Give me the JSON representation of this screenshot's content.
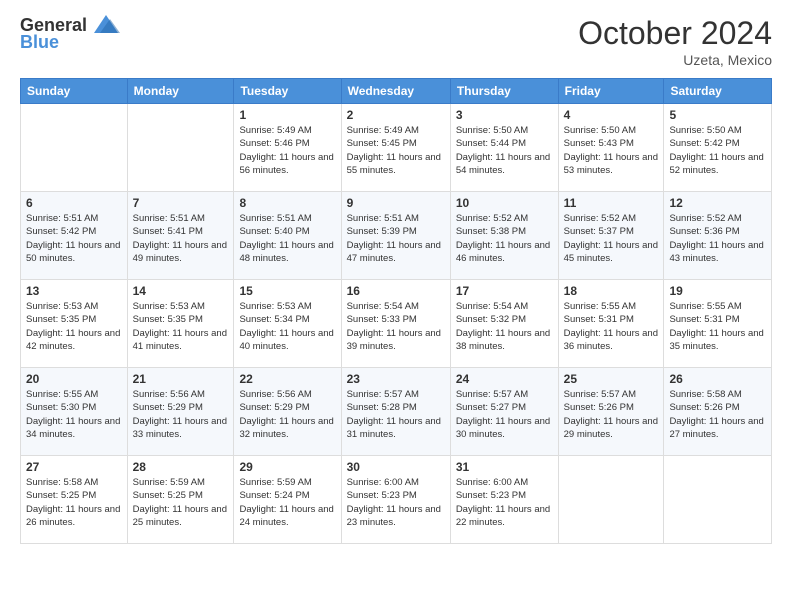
{
  "logo": {
    "line1": "General",
    "line2": "Blue"
  },
  "title": "October 2024",
  "location": "Uzeta, Mexico",
  "weekdays": [
    "Sunday",
    "Monday",
    "Tuesday",
    "Wednesday",
    "Thursday",
    "Friday",
    "Saturday"
  ],
  "weeks": [
    [
      {
        "day": "",
        "sunrise": "",
        "sunset": "",
        "daylight": ""
      },
      {
        "day": "",
        "sunrise": "",
        "sunset": "",
        "daylight": ""
      },
      {
        "day": "1",
        "sunrise": "Sunrise: 5:49 AM",
        "sunset": "Sunset: 5:46 PM",
        "daylight": "Daylight: 11 hours and 56 minutes."
      },
      {
        "day": "2",
        "sunrise": "Sunrise: 5:49 AM",
        "sunset": "Sunset: 5:45 PM",
        "daylight": "Daylight: 11 hours and 55 minutes."
      },
      {
        "day": "3",
        "sunrise": "Sunrise: 5:50 AM",
        "sunset": "Sunset: 5:44 PM",
        "daylight": "Daylight: 11 hours and 54 minutes."
      },
      {
        "day": "4",
        "sunrise": "Sunrise: 5:50 AM",
        "sunset": "Sunset: 5:43 PM",
        "daylight": "Daylight: 11 hours and 53 minutes."
      },
      {
        "day": "5",
        "sunrise": "Sunrise: 5:50 AM",
        "sunset": "Sunset: 5:42 PM",
        "daylight": "Daylight: 11 hours and 52 minutes."
      }
    ],
    [
      {
        "day": "6",
        "sunrise": "Sunrise: 5:51 AM",
        "sunset": "Sunset: 5:42 PM",
        "daylight": "Daylight: 11 hours and 50 minutes."
      },
      {
        "day": "7",
        "sunrise": "Sunrise: 5:51 AM",
        "sunset": "Sunset: 5:41 PM",
        "daylight": "Daylight: 11 hours and 49 minutes."
      },
      {
        "day": "8",
        "sunrise": "Sunrise: 5:51 AM",
        "sunset": "Sunset: 5:40 PM",
        "daylight": "Daylight: 11 hours and 48 minutes."
      },
      {
        "day": "9",
        "sunrise": "Sunrise: 5:51 AM",
        "sunset": "Sunset: 5:39 PM",
        "daylight": "Daylight: 11 hours and 47 minutes."
      },
      {
        "day": "10",
        "sunrise": "Sunrise: 5:52 AM",
        "sunset": "Sunset: 5:38 PM",
        "daylight": "Daylight: 11 hours and 46 minutes."
      },
      {
        "day": "11",
        "sunrise": "Sunrise: 5:52 AM",
        "sunset": "Sunset: 5:37 PM",
        "daylight": "Daylight: 11 hours and 45 minutes."
      },
      {
        "day": "12",
        "sunrise": "Sunrise: 5:52 AM",
        "sunset": "Sunset: 5:36 PM",
        "daylight": "Daylight: 11 hours and 43 minutes."
      }
    ],
    [
      {
        "day": "13",
        "sunrise": "Sunrise: 5:53 AM",
        "sunset": "Sunset: 5:35 PM",
        "daylight": "Daylight: 11 hours and 42 minutes."
      },
      {
        "day": "14",
        "sunrise": "Sunrise: 5:53 AM",
        "sunset": "Sunset: 5:35 PM",
        "daylight": "Daylight: 11 hours and 41 minutes."
      },
      {
        "day": "15",
        "sunrise": "Sunrise: 5:53 AM",
        "sunset": "Sunset: 5:34 PM",
        "daylight": "Daylight: 11 hours and 40 minutes."
      },
      {
        "day": "16",
        "sunrise": "Sunrise: 5:54 AM",
        "sunset": "Sunset: 5:33 PM",
        "daylight": "Daylight: 11 hours and 39 minutes."
      },
      {
        "day": "17",
        "sunrise": "Sunrise: 5:54 AM",
        "sunset": "Sunset: 5:32 PM",
        "daylight": "Daylight: 11 hours and 38 minutes."
      },
      {
        "day": "18",
        "sunrise": "Sunrise: 5:55 AM",
        "sunset": "Sunset: 5:31 PM",
        "daylight": "Daylight: 11 hours and 36 minutes."
      },
      {
        "day": "19",
        "sunrise": "Sunrise: 5:55 AM",
        "sunset": "Sunset: 5:31 PM",
        "daylight": "Daylight: 11 hours and 35 minutes."
      }
    ],
    [
      {
        "day": "20",
        "sunrise": "Sunrise: 5:55 AM",
        "sunset": "Sunset: 5:30 PM",
        "daylight": "Daylight: 11 hours and 34 minutes."
      },
      {
        "day": "21",
        "sunrise": "Sunrise: 5:56 AM",
        "sunset": "Sunset: 5:29 PM",
        "daylight": "Daylight: 11 hours and 33 minutes."
      },
      {
        "day": "22",
        "sunrise": "Sunrise: 5:56 AM",
        "sunset": "Sunset: 5:29 PM",
        "daylight": "Daylight: 11 hours and 32 minutes."
      },
      {
        "day": "23",
        "sunrise": "Sunrise: 5:57 AM",
        "sunset": "Sunset: 5:28 PM",
        "daylight": "Daylight: 11 hours and 31 minutes."
      },
      {
        "day": "24",
        "sunrise": "Sunrise: 5:57 AM",
        "sunset": "Sunset: 5:27 PM",
        "daylight": "Daylight: 11 hours and 30 minutes."
      },
      {
        "day": "25",
        "sunrise": "Sunrise: 5:57 AM",
        "sunset": "Sunset: 5:26 PM",
        "daylight": "Daylight: 11 hours and 29 minutes."
      },
      {
        "day": "26",
        "sunrise": "Sunrise: 5:58 AM",
        "sunset": "Sunset: 5:26 PM",
        "daylight": "Daylight: 11 hours and 27 minutes."
      }
    ],
    [
      {
        "day": "27",
        "sunrise": "Sunrise: 5:58 AM",
        "sunset": "Sunset: 5:25 PM",
        "daylight": "Daylight: 11 hours and 26 minutes."
      },
      {
        "day": "28",
        "sunrise": "Sunrise: 5:59 AM",
        "sunset": "Sunset: 5:25 PM",
        "daylight": "Daylight: 11 hours and 25 minutes."
      },
      {
        "day": "29",
        "sunrise": "Sunrise: 5:59 AM",
        "sunset": "Sunset: 5:24 PM",
        "daylight": "Daylight: 11 hours and 24 minutes."
      },
      {
        "day": "30",
        "sunrise": "Sunrise: 6:00 AM",
        "sunset": "Sunset: 5:23 PM",
        "daylight": "Daylight: 11 hours and 23 minutes."
      },
      {
        "day": "31",
        "sunrise": "Sunrise: 6:00 AM",
        "sunset": "Sunset: 5:23 PM",
        "daylight": "Daylight: 11 hours and 22 minutes."
      },
      {
        "day": "",
        "sunrise": "",
        "sunset": "",
        "daylight": ""
      },
      {
        "day": "",
        "sunrise": "",
        "sunset": "",
        "daylight": ""
      }
    ]
  ]
}
